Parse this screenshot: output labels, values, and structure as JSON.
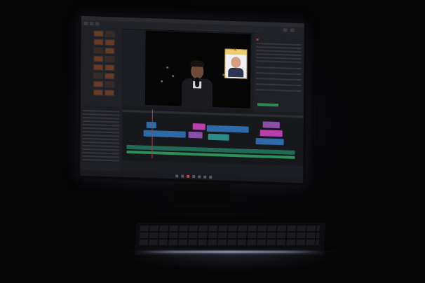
{
  "scene": {
    "description_tag": "video-editing-workstation-dark-room",
    "accent_color": "#d03030",
    "clip_colors": [
      "#2f6aa8",
      "#8a4fa8",
      "#b83fb0",
      "#2a8c8a",
      "#2d8f5a"
    ]
  },
  "monitor": {
    "app_icons": [
      "media-thumbnail-grid",
      "viewer",
      "inspector",
      "timeline",
      "page-switcher"
    ]
  }
}
